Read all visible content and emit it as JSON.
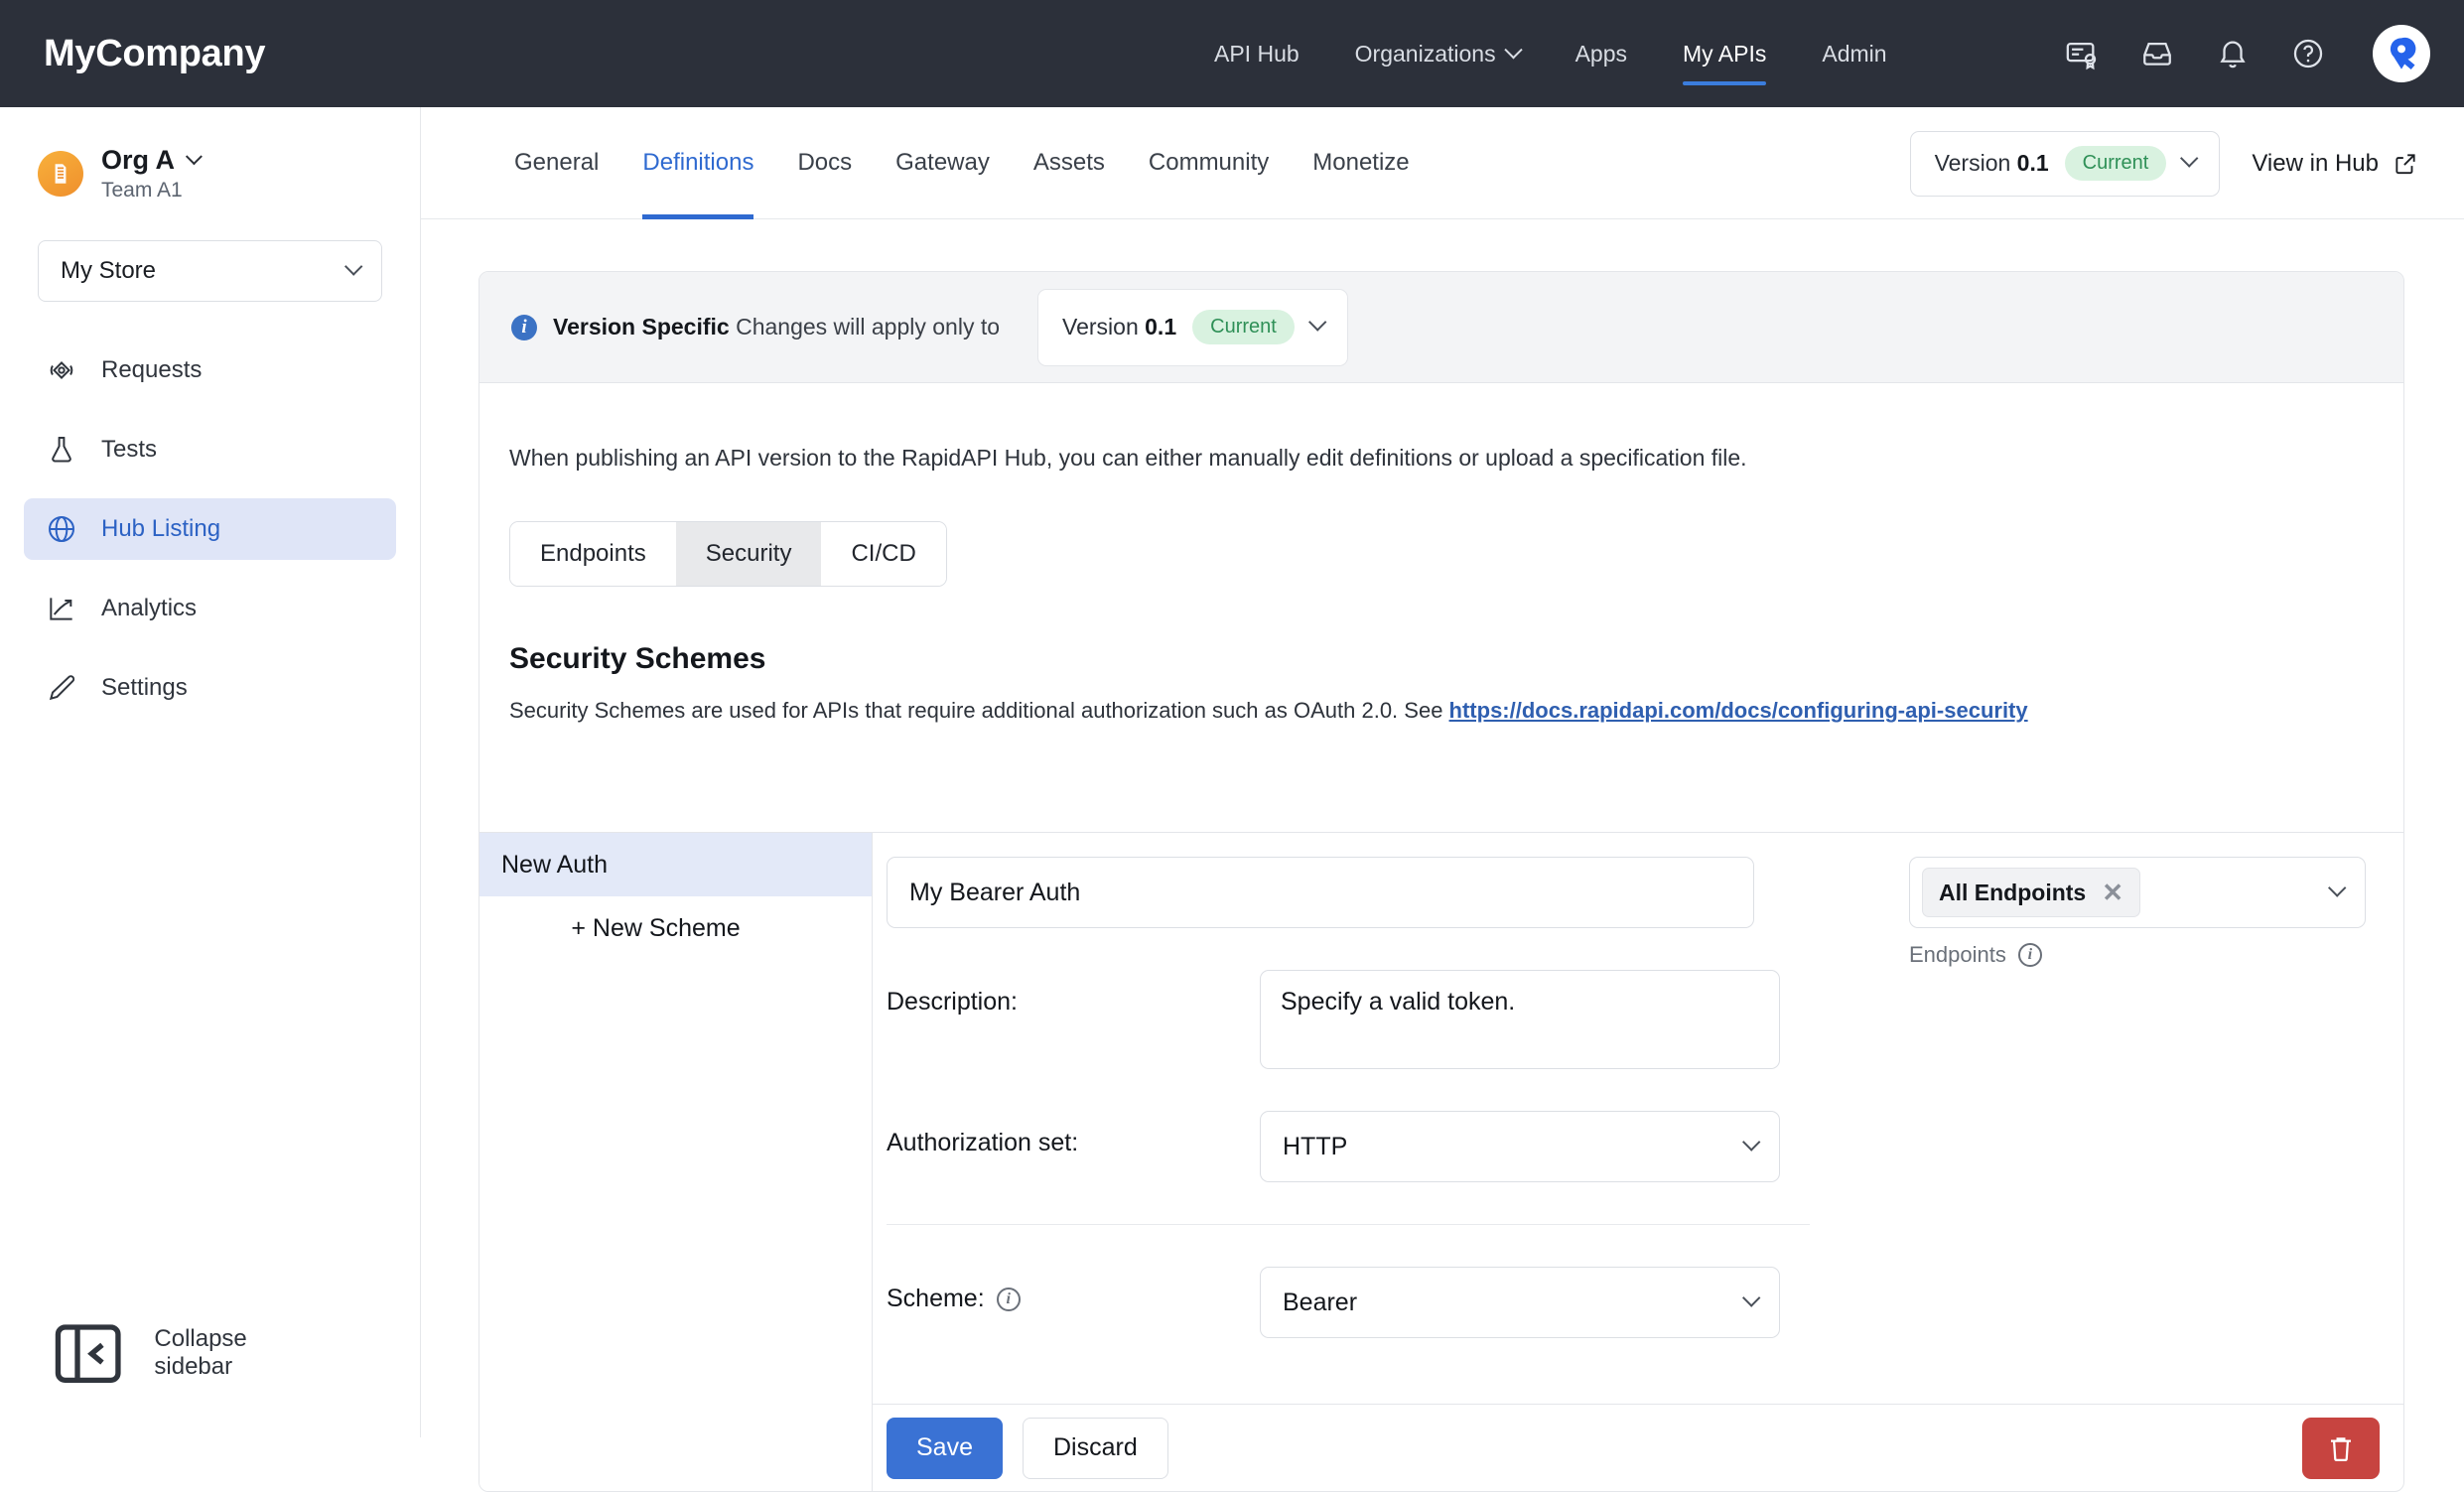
{
  "topbar": {
    "brand": "MyCompany",
    "nav": [
      {
        "label": "API Hub",
        "active": false,
        "has_caret": false
      },
      {
        "label": "Organizations",
        "active": false,
        "has_caret": true
      },
      {
        "label": "Apps",
        "active": false,
        "has_caret": false
      },
      {
        "label": "My APIs",
        "active": true,
        "has_caret": false
      },
      {
        "label": "Admin",
        "active": false,
        "has_caret": false
      }
    ],
    "icons": [
      "certificate-icon",
      "inbox-icon",
      "bell-icon",
      "help-icon"
    ],
    "avatar_letter": "R",
    "avatar_color": "#2563eb"
  },
  "sidebar": {
    "org_name": "Org A",
    "org_team": "Team A1",
    "store_select": "My Store",
    "items": [
      {
        "label": "Requests",
        "icon": "requests-icon",
        "active": false
      },
      {
        "label": "Tests",
        "icon": "flask-icon",
        "active": false
      },
      {
        "label": "Hub Listing",
        "icon": "globe-icon",
        "active": true
      },
      {
        "label": "Analytics",
        "icon": "analytics-icon",
        "active": false
      },
      {
        "label": "Settings",
        "icon": "pencil-icon",
        "active": false
      }
    ],
    "collapse_label": "Collapse sidebar",
    "active_color": "#2c62c4",
    "active_bg": "#dfe5f7"
  },
  "tabs": [
    {
      "label": "General",
      "active": false
    },
    {
      "label": "Definitions",
      "active": true
    },
    {
      "label": "Docs",
      "active": false
    },
    {
      "label": "Gateway",
      "active": false
    },
    {
      "label": "Assets",
      "active": false
    },
    {
      "label": "Community",
      "active": false
    },
    {
      "label": "Monetize",
      "active": false
    }
  ],
  "header_version": {
    "prefix": "Version",
    "number": "0.1",
    "badge": "Current",
    "badge_color": "#2f9057"
  },
  "view_in_hub": "View in Hub",
  "banner": {
    "title": "Version Specific",
    "text": "Changes will apply only to",
    "version_prefix": "Version",
    "version_number": "0.1",
    "version_badge": "Current"
  },
  "card": {
    "description": "When publishing an API version to the RapidAPI Hub, you can either manually edit definitions or upload a specification file.",
    "segments": [
      {
        "label": "Endpoints",
        "active": false
      },
      {
        "label": "Security",
        "active": true
      },
      {
        "label": "CI/CD",
        "active": false
      }
    ],
    "section_title": "Security Schemes",
    "section_sub_prefix": "Security Schemes are used for APIs that require additional authorization such as OAuth 2.0. See ",
    "section_link": "https://docs.rapidapi.com/docs/configuring-api-security"
  },
  "schemes": {
    "items": [
      {
        "label": "New Auth",
        "active": true
      }
    ],
    "new_scheme_label": "+ New Scheme"
  },
  "detail": {
    "name_value": "My Bearer Auth",
    "endpoints_chip": "All Endpoints",
    "endpoints_caption": "Endpoints",
    "description_label": "Description:",
    "description_value": "Specify a valid token.",
    "authorization_label": "Authorization set:",
    "authorization_value": "HTTP",
    "scheme_label": "Scheme:",
    "scheme_value": "Bearer"
  },
  "footer": {
    "save_label": "Save",
    "discard_label": "Discard",
    "delete_icon": "trash-icon",
    "save_color": "#3a72d4",
    "delete_color": "#c74440"
  }
}
